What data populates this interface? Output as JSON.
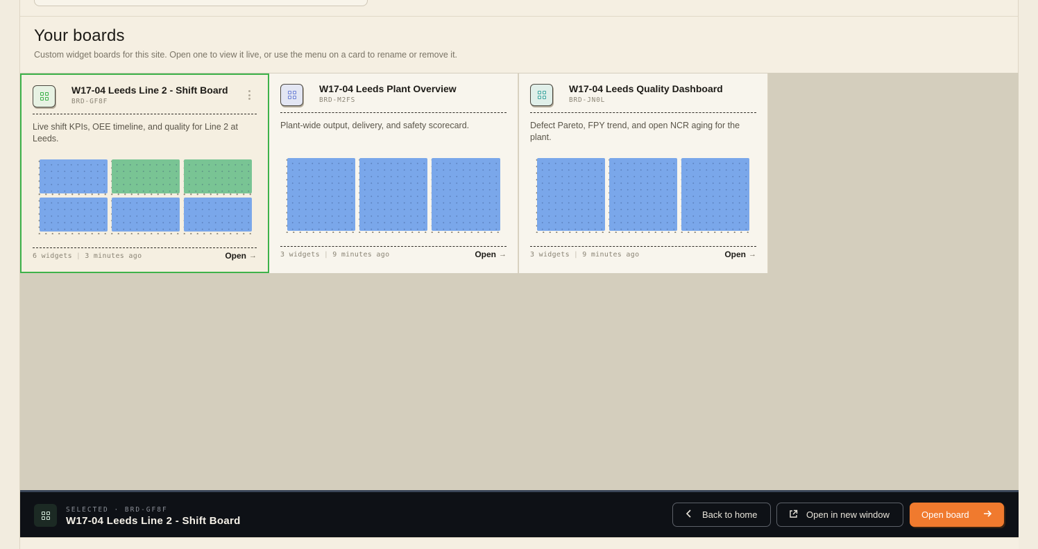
{
  "header": {
    "title": "Your boards",
    "subtitle": "Custom widget boards for this site. Open one to view it live, or use the menu on a card to rename or remove it."
  },
  "cards": [
    {
      "title": "W17-04 Leeds Line 2 - Shift Board",
      "id": "BRD-GF8F",
      "description": "Live shift KPIs, OEE timeline, and quality for Line 2 at Leeds.",
      "widgets": "6 widgets",
      "updated": "3 minutes ago",
      "open_label": "Open",
      "icon_color": "#3db24a",
      "tile_colors": [
        "blue",
        "green",
        "green",
        "blue",
        "blue",
        "blue"
      ]
    },
    {
      "title": "W17-04 Leeds Plant Overview",
      "id": "BRD-M2FS",
      "description": "Plant-wide output, delivery, and safety scorecard.",
      "widgets": "3 widgets",
      "updated": "9 minutes ago",
      "open_label": "Open",
      "icon_color": "#6b7fd6",
      "tile_colors": [
        "blue",
        "blue",
        "blue"
      ]
    },
    {
      "title": "W17-04 Leeds Quality Dashboard",
      "id": "BRD-JN0L",
      "description": "Defect Pareto, FPY trend, and open NCR aging for the plant.",
      "widgets": "3 widgets",
      "updated": "9 minutes ago",
      "open_label": "Open",
      "icon_color": "#3aa6a0",
      "tile_colors": [
        "blue",
        "blue",
        "blue"
      ]
    }
  ],
  "footer": {
    "kicker": "SELECTED · BRD-GF8F",
    "selected_title": "W17-04 Leeds Line 2 - Shift Board",
    "back_label": "Back to home",
    "new_window_label": "Open in new window",
    "open_board_label": "Open board"
  },
  "icons": {
    "board": "grid-icon",
    "back": "chevron-left-icon",
    "new_window": "external-link-icon",
    "open": "arrow-right-icon"
  },
  "colors": {
    "accent": "#f07a2e",
    "selected_border": "#3db24a",
    "tile_blue": "#7aa7ea",
    "tile_green": "#79c494"
  }
}
